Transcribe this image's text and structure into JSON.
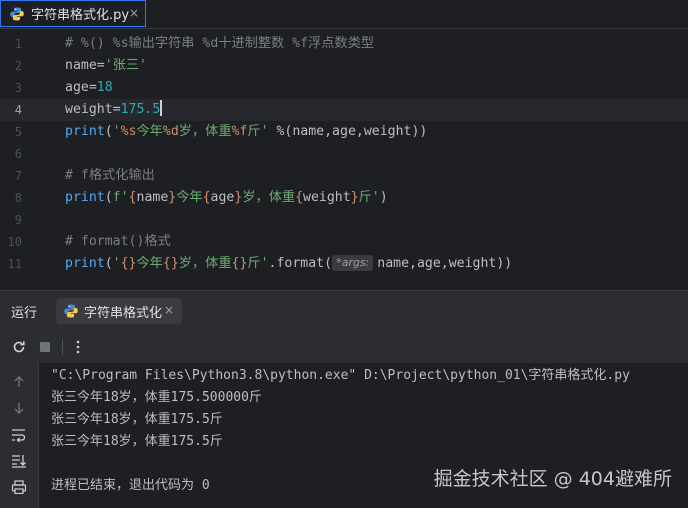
{
  "editor_tab": {
    "label": "字符串格式化.py",
    "close": "×",
    "icon": "python-file-icon"
  },
  "editor": {
    "line_numbers": [
      "1",
      "2",
      "3",
      "4",
      "5",
      "6",
      "7",
      "8",
      "9",
      "10",
      "11"
    ],
    "current_line": 4,
    "lines": [
      [
        {
          "t": "# %() %s输出字符串 %d十进制整数 %f浮点数类型",
          "c": "cmt"
        }
      ],
      [
        {
          "t": "name=",
          "c": ""
        },
        {
          "t": "'张三'",
          "c": "str"
        }
      ],
      [
        {
          "t": "age=",
          "c": ""
        },
        {
          "t": "18",
          "c": "num"
        }
      ],
      [
        {
          "t": "weight=",
          "c": ""
        },
        {
          "t": "175.5",
          "c": "num"
        }
      ],
      [
        {
          "t": "print",
          "c": "fn"
        },
        {
          "t": "(",
          "c": ""
        },
        {
          "t": "'",
          "c": "str"
        },
        {
          "t": "%s",
          "c": "esc"
        },
        {
          "t": "今年",
          "c": "str"
        },
        {
          "t": "%d",
          "c": "esc"
        },
        {
          "t": "岁，体重",
          "c": "str"
        },
        {
          "t": "%f",
          "c": "esc"
        },
        {
          "t": "斤' ",
          "c": "str"
        },
        {
          "t": "%(name,age,weight))",
          "c": ""
        }
      ],
      [],
      [
        {
          "t": "# f格式化输出",
          "c": "cmt"
        }
      ],
      [
        {
          "t": "print",
          "c": "fn"
        },
        {
          "t": "(",
          "c": ""
        },
        {
          "t": "f'",
          "c": "str"
        },
        {
          "t": "{",
          "c": "esc"
        },
        {
          "t": "name",
          "c": "ival"
        },
        {
          "t": "}",
          "c": "esc"
        },
        {
          "t": "今年",
          "c": "str"
        },
        {
          "t": "{",
          "c": "esc"
        },
        {
          "t": "age",
          "c": "ival"
        },
        {
          "t": "}",
          "c": "esc"
        },
        {
          "t": "岁，体重",
          "c": "str"
        },
        {
          "t": "{",
          "c": "esc"
        },
        {
          "t": "weight",
          "c": "ival"
        },
        {
          "t": "}",
          "c": "esc"
        },
        {
          "t": "斤'",
          "c": "str"
        },
        {
          "t": ")",
          "c": ""
        }
      ],
      [],
      [
        {
          "t": "# format()格式",
          "c": "cmt"
        }
      ],
      [
        {
          "t": "print",
          "c": "fn"
        },
        {
          "t": "(",
          "c": ""
        },
        {
          "t": "'",
          "c": "str"
        },
        {
          "t": "{}",
          "c": "esc"
        },
        {
          "t": "今年",
          "c": "str"
        },
        {
          "t": "{}",
          "c": "esc"
        },
        {
          "t": "岁，体重",
          "c": "str"
        },
        {
          "t": "{}",
          "c": "esc"
        },
        {
          "t": "斤'",
          "c": "str"
        },
        {
          "t": ".format(",
          "c": ""
        },
        {
          "t": "*args:",
          "c": "hint"
        },
        {
          "t": "name,age,weight))",
          "c": ""
        }
      ]
    ]
  },
  "run_panel": {
    "title": "运行",
    "tab_label": "字符串格式化",
    "tab_close": "×",
    "toolbar_icons": [
      "rerun-icon",
      "stop-icon",
      "more-options-icon"
    ],
    "sidebar_icons": [
      "scroll-up-icon",
      "scroll-down-icon",
      "soft-wrap-icon",
      "scroll-to-end-icon",
      "print-icon"
    ],
    "output": [
      "\"C:\\Program Files\\Python3.8\\python.exe\" D:\\Project\\python_01\\字符串格式化.py",
      "张三今年18岁，体重175.500000斤",
      "张三今年18岁，体重175.5斤",
      "张三今年18岁，体重175.5斤",
      "",
      "进程已结束，退出代码为 0"
    ]
  },
  "watermark": "掘金技术社区 @ 404避难所"
}
